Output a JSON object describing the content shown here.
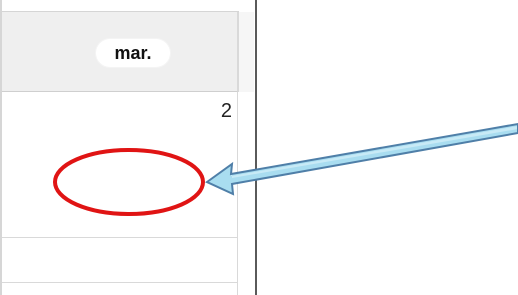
{
  "calendar": {
    "header_label": "mar.",
    "day_number": "2"
  },
  "annotation": {
    "circle_color": "#e01414",
    "arrow_fill": "#a9ddf0",
    "arrow_stroke": "#4f7fa8",
    "arrow_shade": "#cfeef8"
  }
}
